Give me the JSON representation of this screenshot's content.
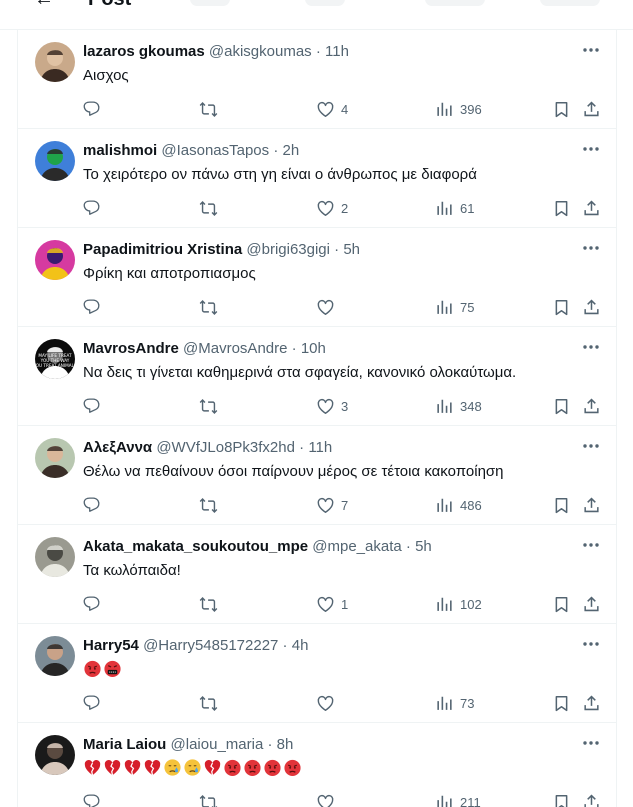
{
  "header": {
    "back_glyph": "←",
    "title": "Post"
  },
  "replies": [
    {
      "name": "lazaros gkoumas",
      "handle": "@akisgkoumas",
      "time": "11h",
      "text": "Αισχος",
      "emojis": [],
      "likes": "4",
      "views": "396",
      "avatar": {
        "bg": "#c9a98a",
        "fg": "#3a2a22",
        "accent": "#e0c2a4"
      }
    },
    {
      "name": "malishmoi",
      "handle": "@IasonasTapos",
      "time": "2h",
      "text": "Το χειρότερο ον πάνω στη γη είναι ο άνθρωπος με διαφορά",
      "emojis": [],
      "likes": "2",
      "views": "61",
      "avatar": {
        "bg": "#3f7fd9",
        "fg": "#2a2a2a",
        "accent": "#1fa34a"
      }
    },
    {
      "name": "Papadimitriou Xristina",
      "handle": "@brigi63gigi",
      "time": "5h",
      "text": "Φρίκη και αποτροπιασμος",
      "emojis": [],
      "likes": "",
      "views": "75",
      "avatar": {
        "bg": "#d63aa0",
        "fg": "#f2c218",
        "accent": "#3a1a70"
      }
    },
    {
      "name": "MavrosAndre",
      "handle": "@MavrosAndre",
      "time": "10h",
      "text": "Να δεις τι γίνεται καθημερινά στα σφαγεία, κανονικό ολοκαύτωμα.",
      "emojis": [],
      "likes": "3",
      "views": "348",
      "avatar": {
        "bg": "#0b0b0b",
        "fg": "#ffffff",
        "accent": "#777777"
      }
    },
    {
      "name": "ΑλεξΑννα",
      "handle": "@WVfJLo8Pk3fx2hd",
      "time": "11h",
      "text": "Θέλω να πεθαίνουν όσοι παίρνουν μέρος  σε τέτοια κακοποίηση",
      "emojis": [],
      "likes": "7",
      "views": "486",
      "avatar": {
        "bg": "#b8c7b0",
        "fg": "#3a2e28",
        "accent": "#d9b79a"
      }
    },
    {
      "name": "Akata_makata_soukoutou_mpe",
      "handle": "@mpe_akata",
      "time": "5h",
      "text": "Τα κωλόπαιδα!",
      "emojis": [],
      "likes": "1",
      "views": "102",
      "avatar": {
        "bg": "#9a9a90",
        "fg": "#e8e8e0",
        "accent": "#4a4a44"
      }
    },
    {
      "name": "Harry54",
      "handle": "@Harry5485172227",
      "time": "4h",
      "text": "",
      "emojis": [
        "angry",
        "cursing"
      ],
      "likes": "",
      "views": "73",
      "avatar": {
        "bg": "#7c8c96",
        "fg": "#262626",
        "accent": "#c9a288"
      }
    },
    {
      "name": "Maria Laiou",
      "handle": "@laiou_maria",
      "time": "8h",
      "text": "",
      "emojis": [
        "broken-heart",
        "broken-heart",
        "broken-heart",
        "broken-heart",
        "crying",
        "crying",
        "broken-heart",
        "angry",
        "angry",
        "angry",
        "angry"
      ],
      "likes": "",
      "views": "211",
      "avatar": {
        "bg": "#1a1a1a",
        "fg": "#d8c8bc",
        "accent": "#5a4a40"
      }
    }
  ],
  "icons": {
    "reply": "reply-icon",
    "retweet": "retweet-icon",
    "like": "heart-icon",
    "views": "views-icon",
    "bookmark": "bookmark-icon",
    "share": "share-icon",
    "more": "more-icon"
  },
  "colors": {
    "text": "#0f1419",
    "secondary": "#536471",
    "border": "#eff3f4",
    "angry_red": "#e2343a",
    "heart_red": "#d61f2b"
  }
}
